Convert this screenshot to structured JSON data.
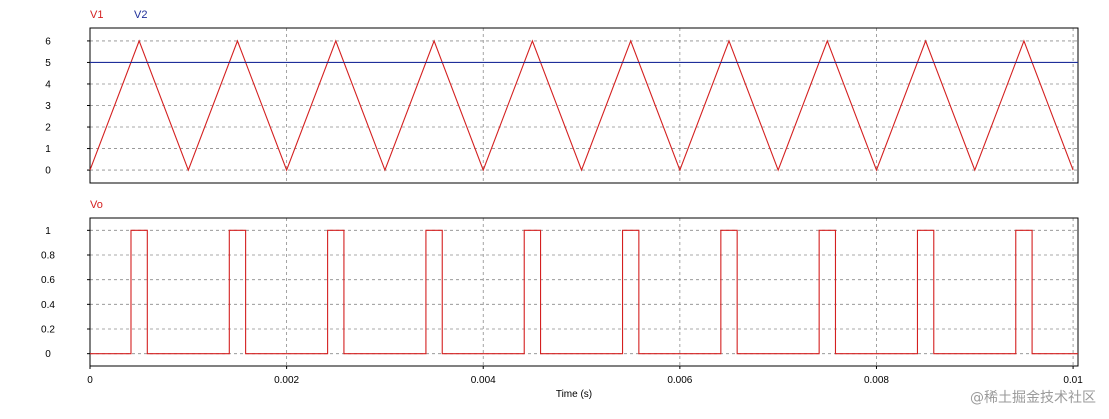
{
  "watermark": "@稀土掘金技术社区",
  "chart_data": [
    {
      "type": "line",
      "title": "",
      "xlabel": "",
      "ylabel": "",
      "xlim": [
        0,
        0.01005
      ],
      "ylim": [
        -0.6,
        6.6
      ],
      "xticks_shown": false,
      "yticks": [
        0,
        1,
        2,
        3,
        4,
        5,
        6
      ],
      "ytick_labels": [
        "0",
        "1",
        "2",
        "3",
        "4",
        "5",
        "6"
      ],
      "grid": true,
      "legend_position": "top-left",
      "series": [
        {
          "name": "V1",
          "color": "#d42020",
          "x": [
            0,
            0.0005,
            0.001,
            0.0015,
            0.002,
            0.0025,
            0.003,
            0.0035,
            0.004,
            0.0045,
            0.005,
            0.0055,
            0.006,
            0.0065,
            0.007,
            0.0075,
            0.008,
            0.0085,
            0.009,
            0.0095,
            0.01
          ],
          "y": [
            0,
            6,
            0,
            6,
            0,
            6,
            0,
            6,
            0,
            6,
            0,
            6,
            0,
            6,
            0,
            6,
            0,
            6,
            0,
            6,
            0
          ]
        },
        {
          "name": "V2",
          "color": "#1f2f9a",
          "x": [
            0,
            0.01005
          ],
          "y": [
            5,
            5
          ]
        }
      ]
    },
    {
      "type": "line",
      "title": "",
      "xlabel": "Time (s)",
      "ylabel": "",
      "xlim": [
        0,
        0.01005
      ],
      "ylim": [
        -0.1,
        1.1
      ],
      "xticks": [
        0,
        0.002,
        0.004,
        0.006,
        0.008,
        0.01
      ],
      "xtick_labels": [
        "0",
        "0.002",
        "0.004",
        "0.006",
        "0.008",
        "0.01"
      ],
      "yticks": [
        0,
        0.2,
        0.4,
        0.6,
        0.8,
        1
      ],
      "ytick_labels": [
        "0",
        "0.2",
        "0.4",
        "0.6",
        "0.8",
        "1"
      ],
      "grid": true,
      "legend_position": "top-left",
      "series": [
        {
          "name": "Vo",
          "color": "#d42020",
          "x": [
            0,
            0.000417,
            0.000417,
            0.000583,
            0.000583,
            0.001417,
            0.001417,
            0.001583,
            0.001583,
            0.002417,
            0.002417,
            0.002583,
            0.002583,
            0.003417,
            0.003417,
            0.003583,
            0.003583,
            0.004417,
            0.004417,
            0.004583,
            0.004583,
            0.005417,
            0.005417,
            0.005583,
            0.005583,
            0.006417,
            0.006417,
            0.006583,
            0.006583,
            0.007417,
            0.007417,
            0.007583,
            0.007583,
            0.008417,
            0.008417,
            0.008583,
            0.008583,
            0.009417,
            0.009417,
            0.009583,
            0.009583,
            0.01005
          ],
          "y": [
            0,
            0,
            1,
            1,
            0,
            0,
            1,
            1,
            0,
            0,
            1,
            1,
            0,
            0,
            1,
            1,
            0,
            0,
            1,
            1,
            0,
            0,
            1,
            1,
            0,
            0,
            1,
            1,
            0,
            0,
            1,
            1,
            0,
            0,
            1,
            1,
            0,
            0,
            1,
            1,
            0,
            0
          ]
        }
      ]
    }
  ]
}
